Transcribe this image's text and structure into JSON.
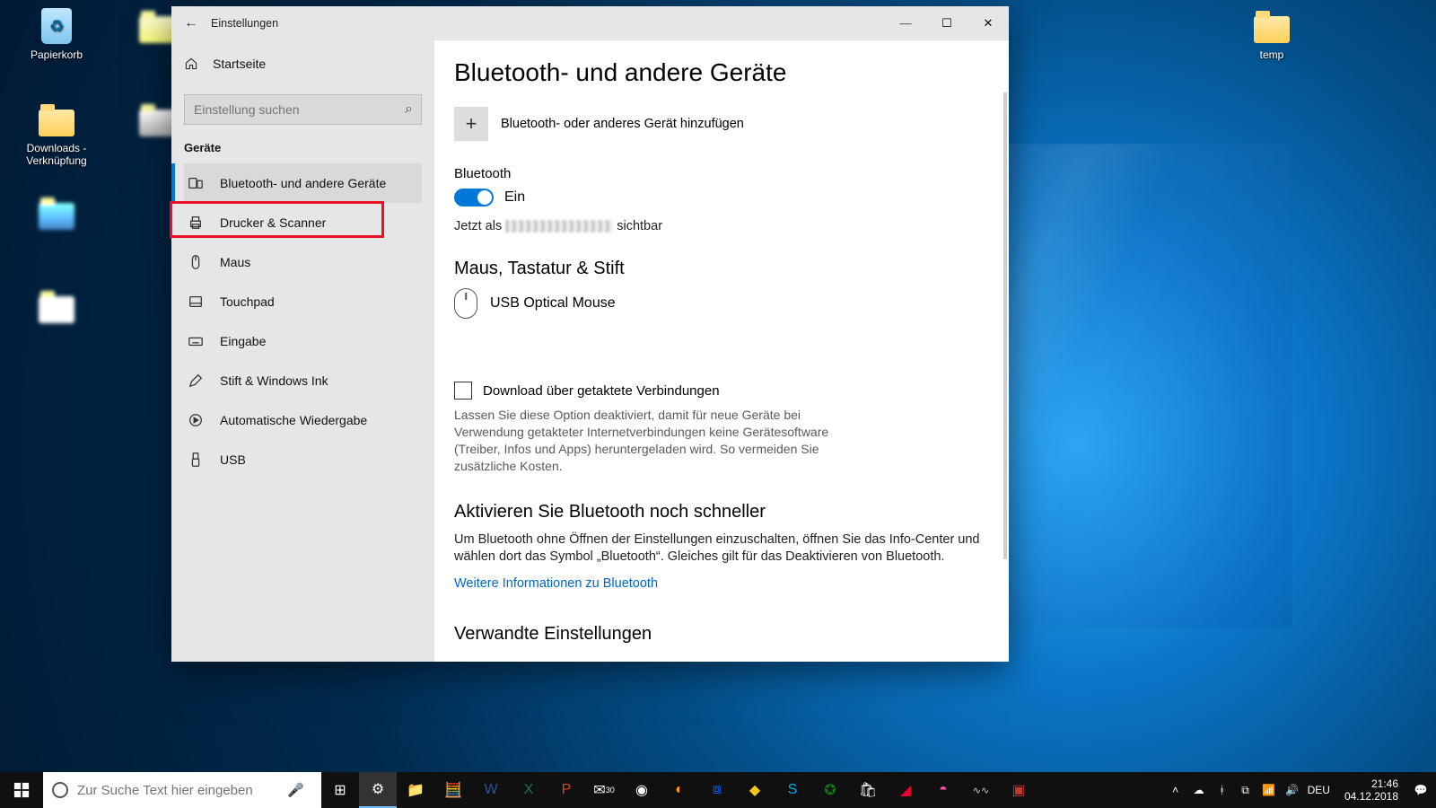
{
  "desktop_icons": {
    "recycle": "Papierkorb",
    "downloads": "Downloads - Verknüpfung",
    "temp": "temp"
  },
  "taskbar": {
    "search_placeholder": "Zur Suche Text hier eingeben",
    "lang": "DEU",
    "time": "21:46",
    "date": "04.12.2018",
    "calendar_badge": "30"
  },
  "window": {
    "title": "Einstellungen",
    "home": "Startseite",
    "search_placeholder": "Einstellung suchen",
    "group": "Geräte",
    "nav": [
      "Bluetooth- und andere Geräte",
      "Drucker & Scanner",
      "Maus",
      "Touchpad",
      "Eingabe",
      "Stift & Windows Ink",
      "Automatische Wiedergabe",
      "USB"
    ]
  },
  "page": {
    "heading": "Bluetooth- und andere Geräte",
    "add_device": "Bluetooth- oder anderes Gerät hinzufügen",
    "bt_label": "Bluetooth",
    "bt_state": "Ein",
    "visible_prefix": "Jetzt als ",
    "visible_suffix": " sichtbar",
    "section_input": "Maus, Tastatur & Stift",
    "device1": "USB Optical Mouse",
    "metered_label": "Download über getaktete Verbindungen",
    "metered_desc": "Lassen Sie diese Option deaktiviert, damit für neue Geräte bei Verwendung getakteter Internetverbindungen keine Gerätesoftware (Treiber, Infos und Apps) heruntergeladen wird. So vermeiden Sie zusätzliche Kosten.",
    "tip_heading": "Aktivieren Sie Bluetooth noch schneller",
    "tip_body": "Um Bluetooth ohne Öffnen der Einstellungen einzuschalten, öffnen Sie das Info-Center und wählen dort das Symbol „Bluetooth“. Gleiches gilt für das Deaktivieren von Bluetooth.",
    "tip_link": "Weitere Informationen zu Bluetooth",
    "related_heading": "Verwandte Einstellungen"
  }
}
